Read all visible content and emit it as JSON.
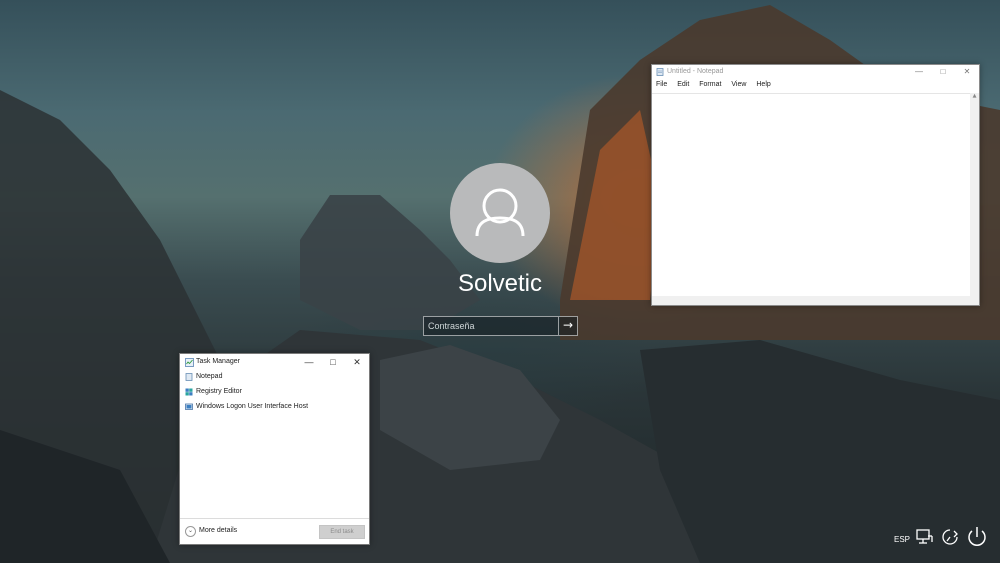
{
  "lockscreen": {
    "username": "Solvetic",
    "password_placeholder": "Contraseña",
    "submit_glyph": "→"
  },
  "notepad": {
    "title": "Untitled - Notepad",
    "menu": [
      "File",
      "Edit",
      "Format",
      "View",
      "Help"
    ],
    "content": ""
  },
  "taskmanager": {
    "title": "Task Manager",
    "items": [
      {
        "label": "Notepad",
        "icon": "notepad-icon"
      },
      {
        "label": "Registry Editor",
        "icon": "registry-editor-icon"
      },
      {
        "label": "Windows Logon User Interface Host",
        "icon": "logon-ui-host-icon"
      }
    ],
    "more_details": "More details",
    "end_task": "End task"
  },
  "tray": {
    "language": "ESP",
    "icons": [
      "network-icon",
      "ease-of-access-icon",
      "power-icon"
    ]
  },
  "colors": {
    "avatar_bg": "#b9babb",
    "end_task_disabled": "#cfcfcf",
    "accent": "#ffffff"
  }
}
